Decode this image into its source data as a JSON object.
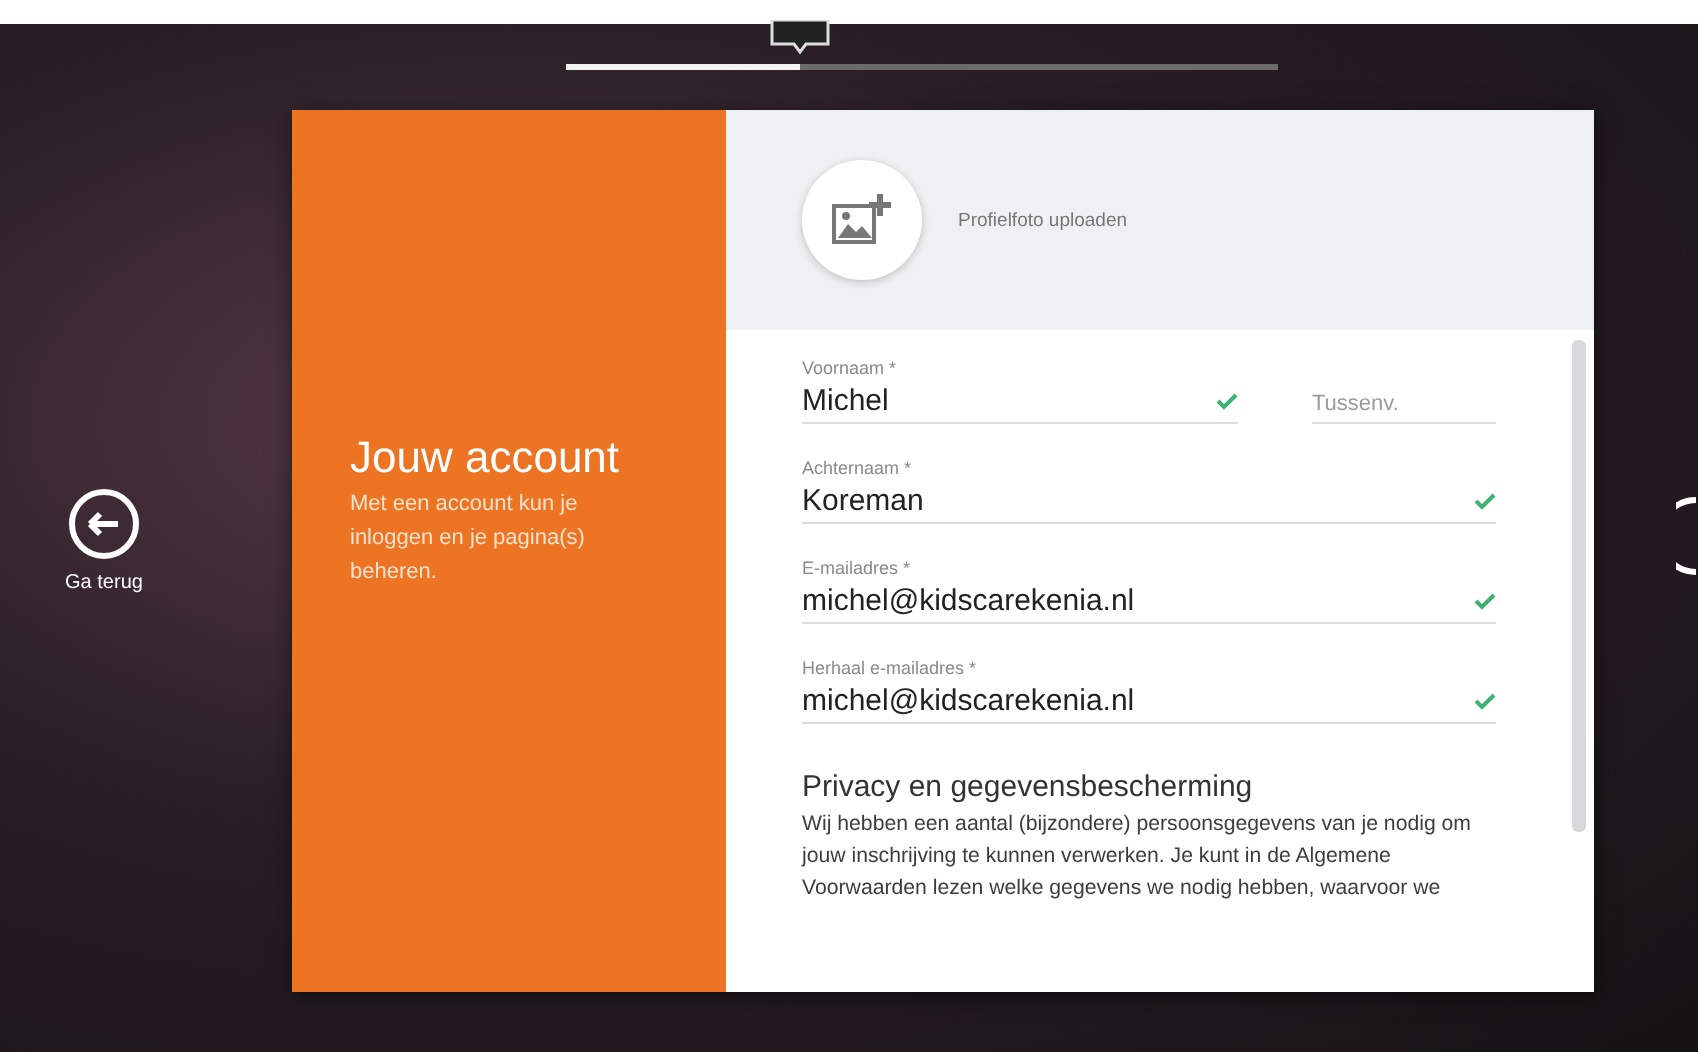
{
  "progress": {
    "level": 0.33
  },
  "back_button": {
    "label": "Ga terug"
  },
  "intro": {
    "title": "Jouw account",
    "text": "Met een account kun je inloggen en je pagina(s) beheren."
  },
  "photo_upload": {
    "label": "Profielfoto uploaden"
  },
  "form_rows": [
    {
      "fields": [
        {
          "label": "Voornaam *",
          "value": "Michel",
          "valid": true
        },
        {
          "placeholder": "Tussenv.",
          "valid": false
        }
      ]
    },
    {
      "fields": [
        {
          "label": "Achternaam *",
          "value": "Koreman",
          "valid": true
        }
      ]
    },
    {
      "fields": [
        {
          "label": "E-mailadres *",
          "value": "michel@kidscarekenia.nl",
          "valid": true
        }
      ]
    },
    {
      "fields": [
        {
          "label": "Herhaal e-mailadres *",
          "value": "michel@kidscarekenia.nl",
          "valid": true
        }
      ]
    }
  ],
  "privacy": {
    "title": "Privacy en gegevensbescherming",
    "text": "Wij hebben een aantal (bijzondere) persoonsgegevens van je nodig om jouw inschrijving te kunnen verwerken. Je kunt in de Algemene Voorwaarden lezen welke gegevens we nodig hebben, waarvoor we"
  }
}
